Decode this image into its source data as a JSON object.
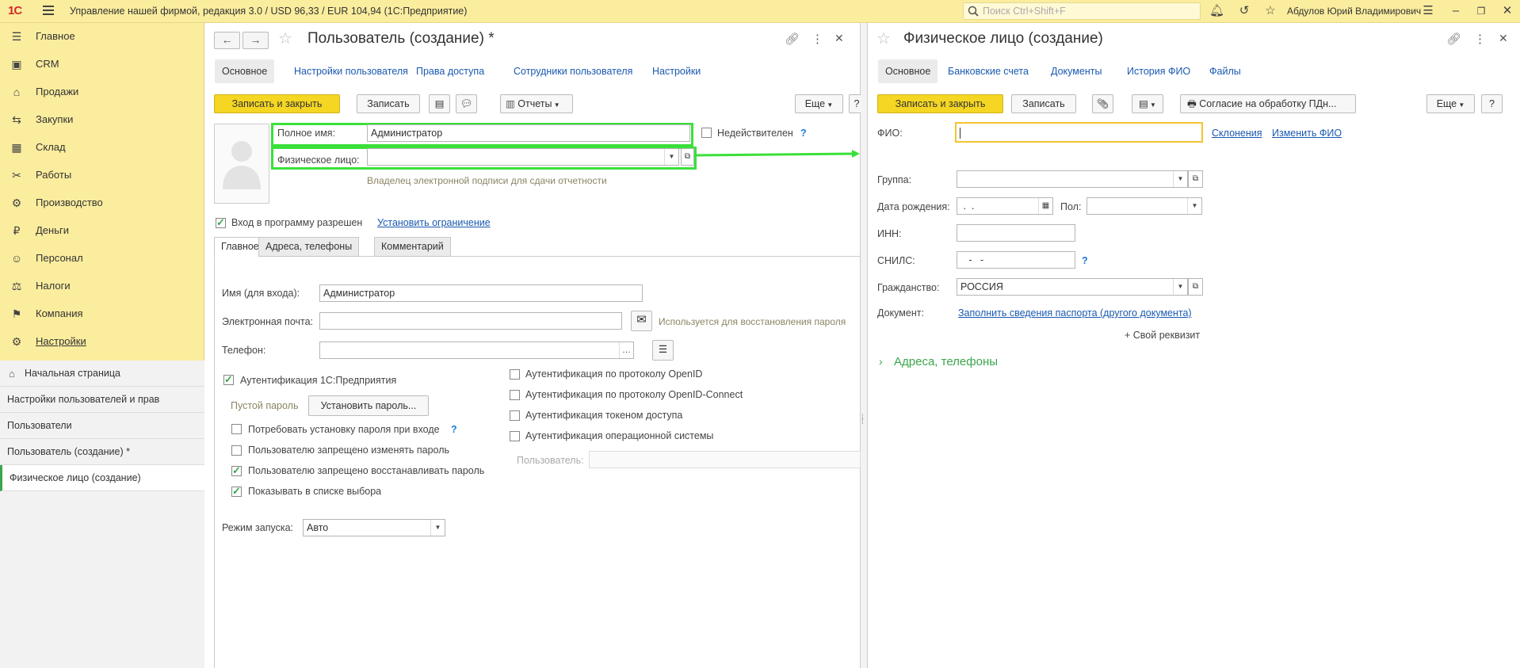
{
  "topbar": {
    "logo": "1С",
    "title": "Управление нашей фирмой, редакция 3.0 / USD 96,33 / EUR 104,94  (1С:Предприятие)",
    "search_placeholder": "Поиск Ctrl+Shift+F",
    "user": "Абдулов Юрий Владимирович"
  },
  "sidebar": {
    "items": [
      {
        "label": "Главное",
        "icon": "menu-lines-icon",
        "glyph": "☰"
      },
      {
        "label": "CRM",
        "icon": "crm-icon",
        "glyph": "▣"
      },
      {
        "label": "Продажи",
        "icon": "sales-icon",
        "glyph": "⌂"
      },
      {
        "label": "Закупки",
        "icon": "purchases-icon",
        "glyph": "⇆"
      },
      {
        "label": "Склад",
        "icon": "warehouse-icon",
        "glyph": "▦"
      },
      {
        "label": "Работы",
        "icon": "works-icon",
        "glyph": "✂"
      },
      {
        "label": "Производство",
        "icon": "production-icon",
        "glyph": "⚙"
      },
      {
        "label": "Деньги",
        "icon": "money-icon",
        "glyph": "₽"
      },
      {
        "label": "Персонал",
        "icon": "personnel-icon",
        "glyph": "☺"
      },
      {
        "label": "Налоги",
        "icon": "taxes-icon",
        "glyph": "⚖"
      },
      {
        "label": "Компания",
        "icon": "company-icon",
        "glyph": "⚑"
      },
      {
        "label": "Настройки",
        "icon": "settings-icon",
        "glyph": "⚙"
      }
    ],
    "open_windows": [
      "Начальная страница",
      "Настройки пользователей и прав",
      "Пользователи",
      "Пользователь (создание) *",
      "Физическое лицо (создание)"
    ]
  },
  "user_form": {
    "title": "Пользователь (создание) *",
    "tabs": [
      "Основное",
      "Настройки пользователя",
      "Права доступа",
      "Сотрудники пользователя",
      "Настройки"
    ],
    "save_close": "Записать и закрыть",
    "save": "Записать",
    "reports": "Отчеты",
    "more": "Еще",
    "full_name_label": "Полное имя:",
    "full_name_value": "Администратор",
    "invalid_label": "Недействителен",
    "person_label": "Физическое лицо:",
    "person_value": "",
    "signature_hint": "Владелец электронной подписи для сдачи отчетности",
    "login_allowed": "Вход в программу разрешен",
    "set_restriction": "Установить ограничение",
    "inner_tabs": [
      "Главное",
      "Адреса, телефоны",
      "Комментарий"
    ],
    "login_name_label": "Имя (для входа):",
    "login_name_value": "Администратор",
    "email_label": "Электронная почта:",
    "email_value": "",
    "email_hint": "Используется для восстановления пароля",
    "phone_label": "Телефон:",
    "phone_value": "",
    "auth_1c": "Аутентификация 1С:Предприятия",
    "empty_password": "Пустой пароль",
    "set_password": "Установить пароль...",
    "require_password": "Потребовать установку пароля при входе",
    "forbid_change": "Пользователю запрещено изменять пароль",
    "forbid_restore": "Пользователю запрещено восстанавливать пароль",
    "show_in_list": "Показывать в списке выбора",
    "auth_openid": "Аутентификация по протоколу OpenID",
    "auth_openid_connect": "Аутентификация по протоколу OpenID-Connect",
    "auth_token": "Аутентификация токеном доступа",
    "auth_os": "Аутентификация операционной системы",
    "os_user_label": "Пользователь:",
    "os_user_value": "",
    "launch_mode_label": "Режим запуска:",
    "launch_mode_value": "Авто",
    "checks": {
      "invalid": false,
      "login_allowed": true,
      "auth_1c": true,
      "require_password": false,
      "forbid_change": false,
      "forbid_restore": true,
      "show_in_list": true,
      "auth_openid": false,
      "auth_openid_connect": false,
      "auth_token": false,
      "auth_os": false
    }
  },
  "person_form": {
    "title": "Физическое лицо (создание)",
    "tabs": [
      "Основное",
      "Банковские счета",
      "Документы",
      "История ФИО",
      "Файлы"
    ],
    "save_close": "Записать и закрыть",
    "save": "Записать",
    "consent": "Согласие на обработку ПДн...",
    "more": "Еще",
    "help": "?",
    "fio_label": "ФИО:",
    "fio_value": "",
    "declensions": "Склонения",
    "change_fio": "Изменить ФИО",
    "group_label": "Группа:",
    "group_value": "",
    "birth_label": "Дата рождения:",
    "birth_value": " .  .",
    "gender_label": "Пол:",
    "gender_value": "",
    "inn_label": "ИНН:",
    "inn_value": "",
    "snils_label": "СНИЛС:",
    "snils_value": "   -   -",
    "citizenship_label": "Гражданство:",
    "citizenship_value": "РОССИЯ",
    "document_label": "Документ:",
    "fill_passport": "Заполнить сведения паспорта (другого документа)",
    "own_attr": "+ Свой реквизит",
    "addresses_group": "Адреса, телефоны"
  },
  "colors": {
    "accent_yellow": "#f4d623",
    "highlight_green": "#3ae03a",
    "section_green": "#3aa64c",
    "link_blue": "#1a59b0"
  }
}
